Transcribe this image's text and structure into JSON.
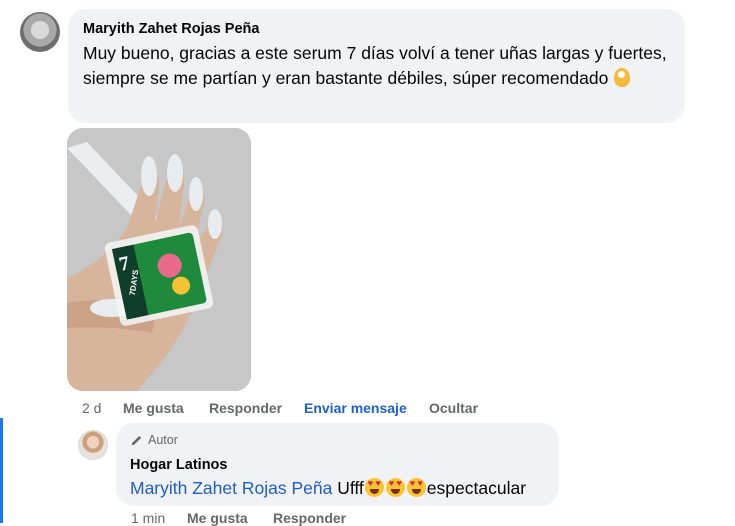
{
  "comment": {
    "author": "Maryith Zahet Rojas Peña",
    "text": "Muy bueno, gracias a este serum 7 días volví a tener uñas largas y fuertes, siempre se me partían y eran bastante débiles, súper recomendado",
    "emoji": "ok-hand-emoji",
    "photo_label": "7DAYS",
    "time": "2 d",
    "actions": {
      "like": "Me gusta",
      "reply": "Responder",
      "message": "Enviar mensaje",
      "hide": "Ocultar"
    }
  },
  "reply": {
    "badge": "Autor",
    "author": "Hogar Latinos",
    "mention": "Maryith Zahet Rojas Peña",
    "text_before": "Ufff",
    "text_after": "espectacular",
    "time": "1 min",
    "actions": {
      "like": "Me gusta",
      "reply": "Responder"
    }
  },
  "colors": {
    "bubble": "#f0f2f5",
    "link": "#1e5fc6",
    "muted": "#65676b",
    "accent_bar": "#1877f2"
  }
}
